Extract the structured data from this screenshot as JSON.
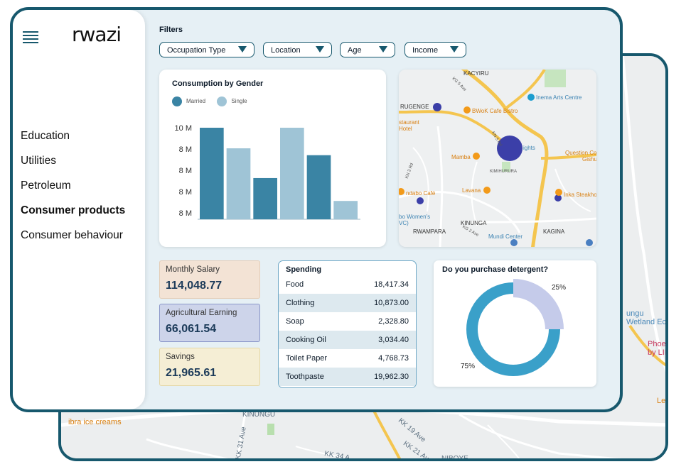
{
  "background_map": {
    "labels": [
      {
        "text": "ibra ice creams",
        "style": "orange"
      },
      {
        "text": "Phoenix",
        "style": "pink"
      },
      {
        "text": "by LINK",
        "style": "pink"
      },
      {
        "text": "ungu",
        "style": "blue"
      },
      {
        "text": "Wetland Eco",
        "style": "blue"
      },
      {
        "text": "Leg",
        "style": "orange"
      },
      {
        "text": "KK 19 Ave",
        "style": "plain"
      },
      {
        "text": "KK 21 Ave",
        "style": "plain"
      },
      {
        "text": "KK 31 Ave",
        "style": "plain"
      },
      {
        "text": "KK 34 A",
        "style": "plain"
      },
      {
        "text": "NIBOYE",
        "style": "plain"
      },
      {
        "text": "KINUNGU",
        "style": "plain"
      }
    ]
  },
  "sidebar": {
    "logo": "rwazi",
    "items": [
      {
        "label": "Education",
        "active": false
      },
      {
        "label": "Utilities",
        "active": false
      },
      {
        "label": "Petroleum",
        "active": false
      },
      {
        "label": "Consumer products",
        "active": true
      },
      {
        "label": "Consumer behaviour",
        "active": false
      }
    ]
  },
  "filters": {
    "title": "Filters",
    "items": [
      {
        "label": "Occupation Type"
      },
      {
        "label": "Location"
      },
      {
        "label": "Age"
      },
      {
        "label": "Income"
      }
    ]
  },
  "consumption_chart": {
    "title": "Consumption by Gender",
    "legend": [
      {
        "label": "Married",
        "color": "#3a84a4"
      },
      {
        "label": "Single",
        "color": "#9fc4d6"
      }
    ]
  },
  "chart_data": [
    {
      "type": "bar",
      "title": "Consumption by Gender",
      "tick_labels": [
        "10 M",
        "8 M",
        "8 M",
        "8 M",
        "8 M"
      ],
      "series": [
        {
          "name": "Married",
          "color": "#3a84a4"
        },
        {
          "name": "Single",
          "color": "#9fc4d6"
        }
      ],
      "bars": [
        {
          "series": "Married",
          "value": 10.0
        },
        {
          "series": "Single",
          "value": 9.1
        },
        {
          "series": "Married",
          "value": 7.8
        },
        {
          "series": "Single",
          "value": 10.0
        },
        {
          "series": "Married",
          "value": 8.8
        },
        {
          "series": "Single",
          "value": 6.8
        }
      ],
      "ylim": [
        6,
        10
      ],
      "grid": false,
      "legend_position": "top-left"
    },
    {
      "type": "pie",
      "title": "Do you purchase detergent?",
      "slices": [
        {
          "label": "25%",
          "value": 25,
          "color": "#c5cbea"
        },
        {
          "label": "75%",
          "value": 75,
          "color": "#3aa0c9"
        }
      ]
    }
  ],
  "map": {
    "labels": [
      {
        "text": "KACYIRU",
        "style": "plain"
      },
      {
        "text": "RUGENGE",
        "style": "plain"
      },
      {
        "text": "BWoK Cafe Bistro",
        "style": "orange"
      },
      {
        "text": "Inema Arts Centre",
        "style": "blue"
      },
      {
        "text": "staurant",
        "style": "orange"
      },
      {
        "text": "Hotel",
        "style": "orange"
      },
      {
        "text": "Mamba",
        "style": "orange"
      },
      {
        "text": "ights",
        "style": "blue"
      },
      {
        "text": "Question Co",
        "style": "orange"
      },
      {
        "text": "Gishu",
        "style": "orange"
      },
      {
        "text": "KIMIHURURA",
        "style": "small"
      },
      {
        "text": "Lavana",
        "style": "orange"
      },
      {
        "text": "Inka Steakho",
        "style": "orange"
      },
      {
        "text": "ndabo Café",
        "style": "orange"
      },
      {
        "text": "bo Women's",
        "style": "blue"
      },
      {
        "text": "VC)",
        "style": "blue"
      },
      {
        "text": "KINUNGA",
        "style": "plain"
      },
      {
        "text": "RWAMPARA",
        "style": "plain"
      },
      {
        "text": "Mundi Center",
        "style": "blue"
      },
      {
        "text": "KAGINA",
        "style": "plain"
      },
      {
        "text": "KG 5 Ave",
        "style": "small"
      },
      {
        "text": "KN 5 Rd",
        "style": "small"
      },
      {
        "text": "KN 3 Rd",
        "style": "small"
      },
      {
        "text": "KG 2 Ave",
        "style": "small"
      }
    ]
  },
  "metrics": [
    {
      "label": "Monthly Salary",
      "value": "114,048.77",
      "bg": "#f3e3d5",
      "border": "#e4cdb7"
    },
    {
      "label": "Agricultural Earning",
      "value": "66,061.54",
      "bg": "#cdd4ea",
      "border": "#8b97c9"
    },
    {
      "label": "Savings",
      "value": "21,965.61",
      "bg": "#f5eed5",
      "border": "#e4d7a6"
    }
  ],
  "spending": {
    "title": "Spending",
    "rows": [
      {
        "item": "Food",
        "amount": "18,417.34"
      },
      {
        "item": "Clothing",
        "amount": "10,873.00"
      },
      {
        "item": "Soap",
        "amount": "2,328.80"
      },
      {
        "item": "Cooking Oil",
        "amount": "3,034.40"
      },
      {
        "item": "Toilet Paper",
        "amount": "4,768.73"
      },
      {
        "item": "Toothpaste",
        "amount": "19,962.30"
      }
    ]
  },
  "detergent": {
    "title": "Do you purchase detergent?",
    "label_small": "25%",
    "label_large": "75%"
  }
}
